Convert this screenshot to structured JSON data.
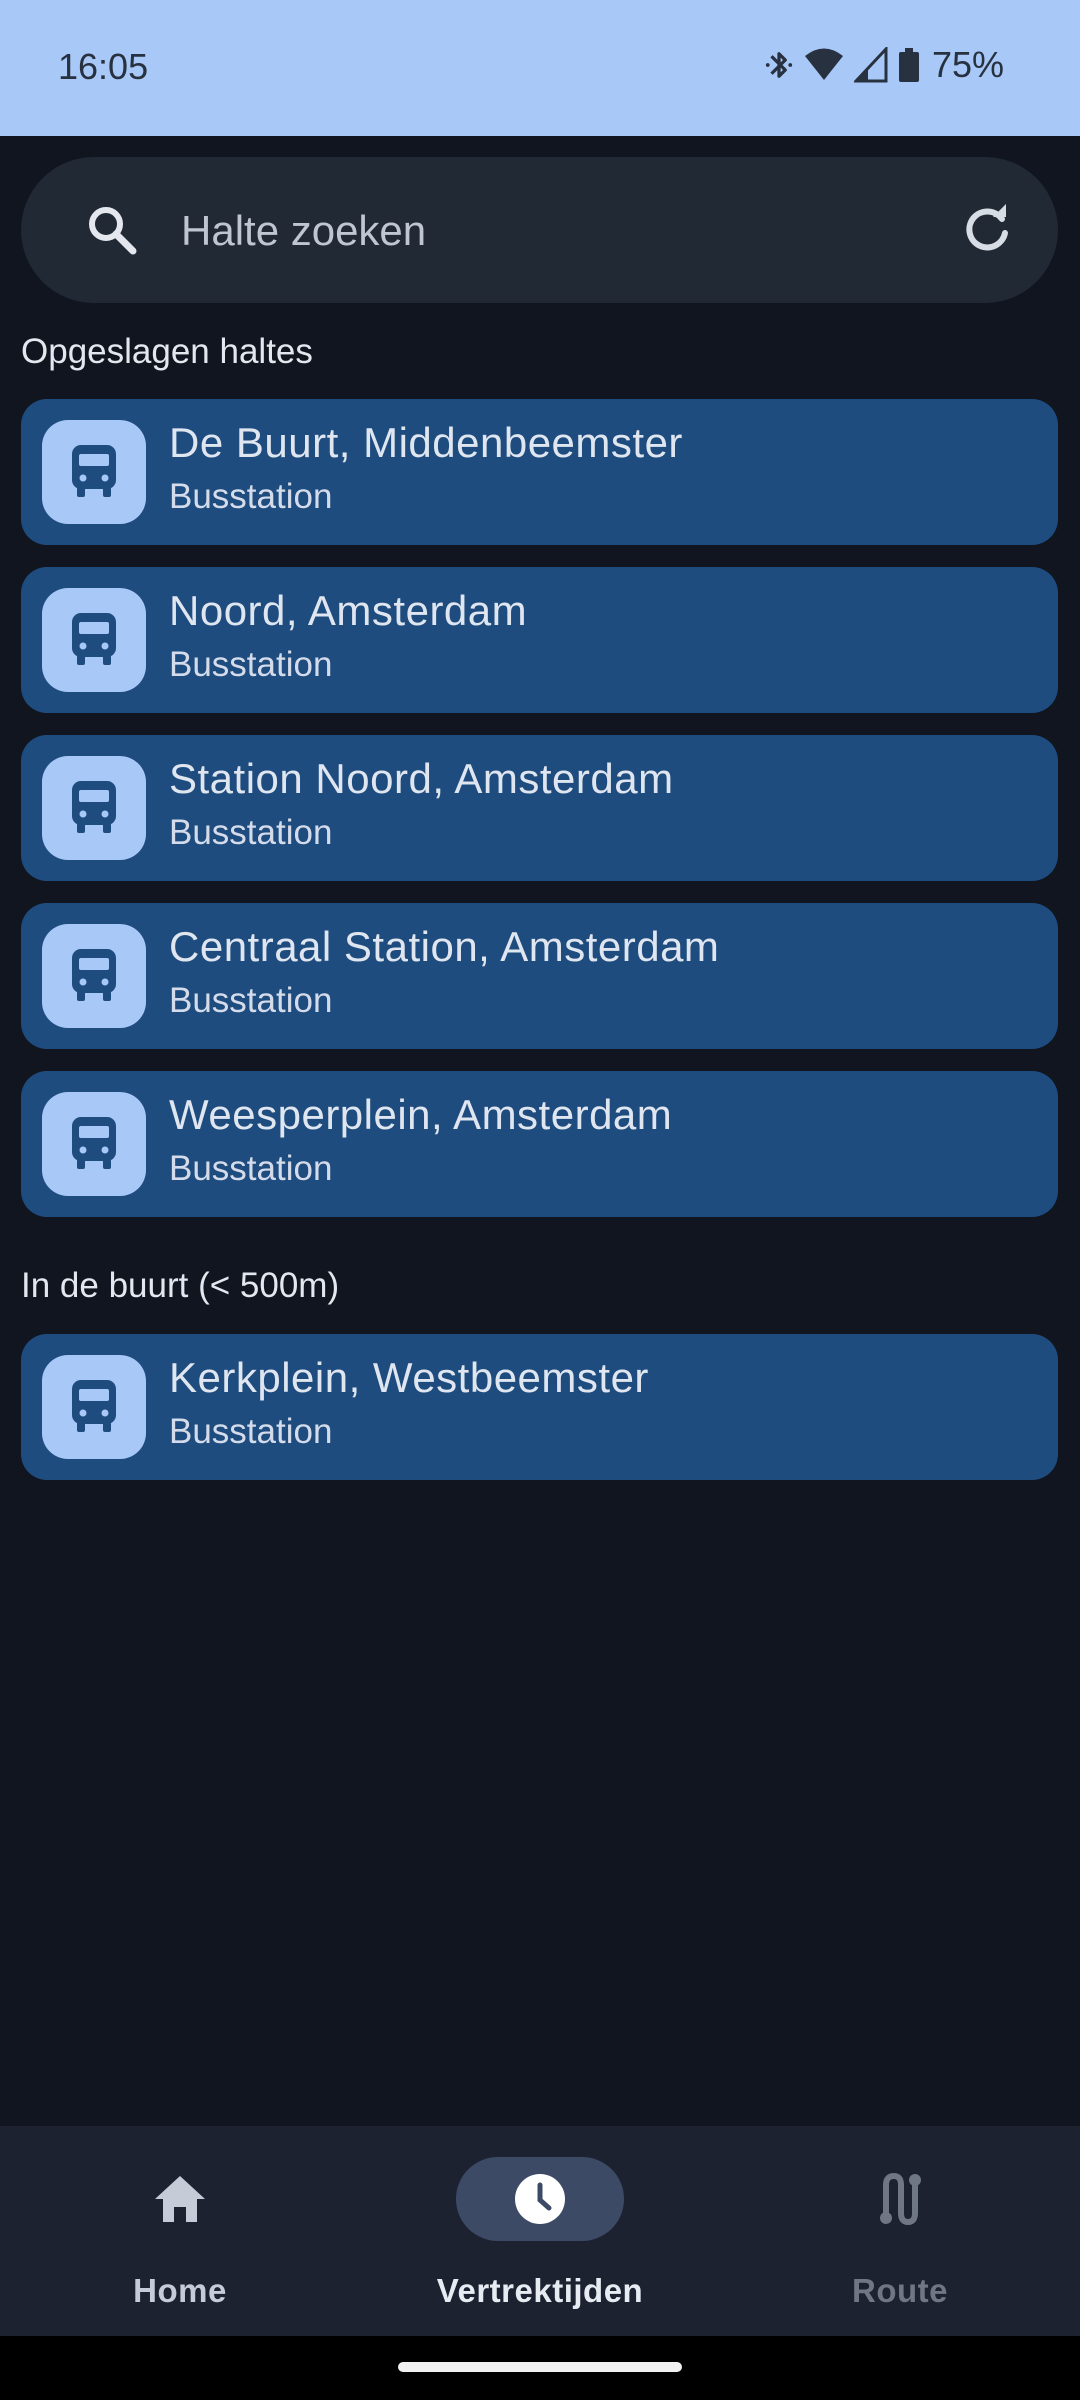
{
  "status_bar": {
    "time": "16:05",
    "battery": "75%",
    "icons": [
      "bluetooth-icon",
      "wifi-icon",
      "cell-signal-icon",
      "battery-icon"
    ]
  },
  "search": {
    "placeholder": "Halte zoeken",
    "value": ""
  },
  "sections": {
    "saved_title": "Opgeslagen haltes",
    "nearby_title": "In de buurt (< 500m)"
  },
  "saved_stops": [
    {
      "name": "De Buurt, Middenbeemster",
      "type": "Busstation",
      "icon": "bus-icon"
    },
    {
      "name": "Noord, Amsterdam",
      "type": "Busstation",
      "icon": "bus-icon"
    },
    {
      "name": "Station Noord, Amsterdam",
      "type": "Busstation",
      "icon": "bus-icon"
    },
    {
      "name": "Centraal Station, Amsterdam",
      "type": "Busstation",
      "icon": "bus-icon"
    },
    {
      "name": "Weesperplein, Amsterdam",
      "type": "Busstation",
      "icon": "bus-icon"
    }
  ],
  "nearby_stops": [
    {
      "name": "Kerkplein, Westbeemster",
      "type": "Busstation",
      "icon": "bus-icon"
    }
  ],
  "bottom_nav": [
    {
      "label": "Home",
      "icon": "home-icon",
      "state": "normal"
    },
    {
      "label": "Vertrektijden",
      "icon": "clock-icon",
      "state": "active"
    },
    {
      "label": "Route",
      "icon": "route-icon",
      "state": "disabled"
    }
  ],
  "colors": {
    "background": "#111520",
    "status_bar": "#a8c8f8",
    "card": "#1f4c7f",
    "icon_chip": "#a8c8f8",
    "nav_bar": "#1d2230"
  }
}
